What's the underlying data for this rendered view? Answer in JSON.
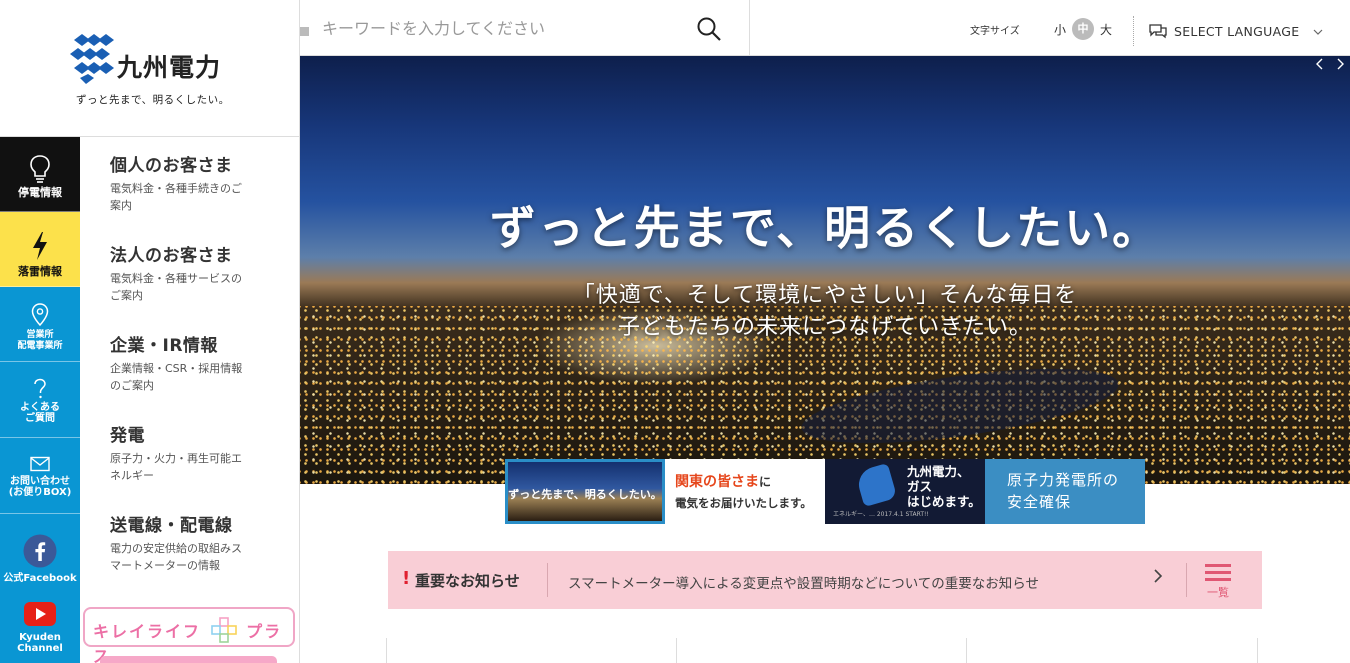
{
  "brand": {
    "name": "九州電力",
    "tagline": "ずっと先まで、明るくしたい。"
  },
  "quick_links": [
    {
      "icon": "lightbulb-icon",
      "label": "停電情報"
    },
    {
      "icon": "lightning-icon",
      "label": "落雷情報"
    },
    {
      "icon": "location-pin-icon",
      "label_line1": "営業所",
      "label_line2": "配電事業所"
    },
    {
      "icon": "question-icon",
      "label_line1": "よくある",
      "label_line2": "ご質問"
    },
    {
      "icon": "mail-icon",
      "label_line1": "お問い合わせ",
      "label_line2": "(お便りBOX)"
    },
    {
      "icon": "facebook-icon",
      "label": "公式Facebook"
    },
    {
      "icon": "youtube-icon",
      "label_line1": "Kyuden",
      "label_line2": "Channel"
    }
  ],
  "menu": [
    {
      "title": "個人のお客さま",
      "desc": "電気料金・各種手続きのご案内"
    },
    {
      "title": "法人のお客さま",
      "desc": "電気料金・各種サービスのご案内"
    },
    {
      "title": "企業・IR情報",
      "desc": "企業情報・CSR・採用情報のご案内"
    },
    {
      "title": "発電",
      "desc": "原子力・火力・再生可能エネルギー"
    },
    {
      "title": "送電線・配電線",
      "desc": "電力の安定供給の取組みスマートメーターの情報"
    }
  ],
  "banner_kirei": {
    "left": "キレイライフ",
    "right": "プラス"
  },
  "search": {
    "placeholder": "キーワードを入力してください",
    "value": ""
  },
  "utility": {
    "font_size_label": "文字サイズ",
    "font_small": "小",
    "font_medium": "中",
    "font_large": "大",
    "language": "SELECT LANGUAGE"
  },
  "hero": {
    "title": "ずっと先まで、明るくしたい。",
    "sub_line1": "「快適で、そして環境にやさしい」そんな毎日を",
    "sub_line2": "子どもたちの未来につなげていきたい。"
  },
  "thumbnails": {
    "t1": "ずっと先まで、明るくしたい。",
    "t2_highlight": "関東の皆さま",
    "t2_suffix": "に",
    "t2_line2": "電気をお届けいたします。",
    "t3_line1": "九州電力、",
    "t3_line2": "ガス",
    "t3_line3": "はじめます。",
    "t3_caption": "エネルギー、…  2017.4.1  START!!",
    "t4_line1": "原子力発電所の",
    "t4_line2": "安全確保"
  },
  "notice": {
    "label": "重要なお知らせ",
    "text": "スマートメーター導入による変更点や設置時期などについての重要なお知らせ",
    "list_label": "一覧"
  },
  "colors": {
    "quick_bar": "#0a96d3",
    "outage_bg": "#111111",
    "lightning_bg": "#fce14b",
    "notice_bg": "#f9ced6",
    "accent_pink": "#e05773",
    "thumb_blue": "#3b8ec3"
  }
}
